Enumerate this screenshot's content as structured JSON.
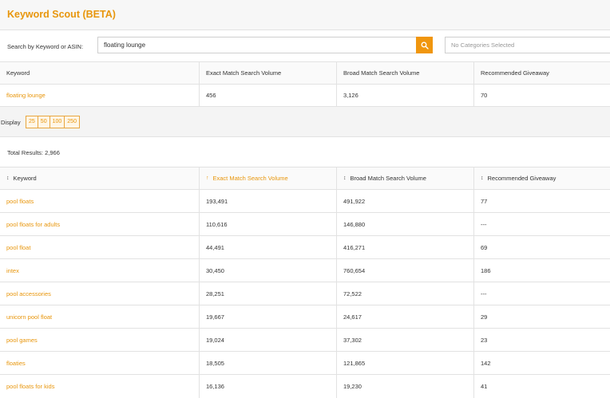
{
  "header": {
    "title": "Keyword Scout (BETA)"
  },
  "search": {
    "label": "Search by Keyword or ASIN:",
    "value": "floating lounge",
    "category_placeholder": "No Categories Selected",
    "button_icon": "search-icon"
  },
  "summary_table": {
    "headers": [
      "Keyword",
      "Exact Match Search Volume",
      "Broad Match Search Volume",
      "Recommended Giveaway"
    ],
    "row": [
      "floating lounge",
      "456",
      "3,126",
      "70"
    ]
  },
  "display": {
    "label": "Display",
    "options": [
      "25",
      "50",
      "100",
      "250"
    ]
  },
  "results": {
    "total_label": "Total Results: 2,966",
    "headers": [
      "Keyword",
      "Exact Match Search Volume",
      "Broad Match Search Volume",
      "Recommended Giveaway"
    ],
    "sort_icons": [
      "↕",
      "↑",
      "↕",
      "↕"
    ],
    "rows": [
      [
        "pool floats",
        "193,491",
        "491,922",
        "77"
      ],
      [
        "pool floats for adults",
        "110,616",
        "146,880",
        "---"
      ],
      [
        "pool float",
        "44,491",
        "416,271",
        "69"
      ],
      [
        "intex",
        "30,450",
        "760,654",
        "186"
      ],
      [
        "pool accessories",
        "28,251",
        "72,522",
        "---"
      ],
      [
        "unicorn pool float",
        "19,667",
        "24,617",
        "29"
      ],
      [
        "pool games",
        "19,024",
        "37,302",
        "23"
      ],
      [
        "floaties",
        "18,505",
        "121,865",
        "142"
      ],
      [
        "pool floats for kids",
        "16,136",
        "19,230",
        "41"
      ]
    ]
  },
  "colors": {
    "accent": "#e8960c",
    "button": "#f0960e",
    "border": "#e2e2e2"
  }
}
